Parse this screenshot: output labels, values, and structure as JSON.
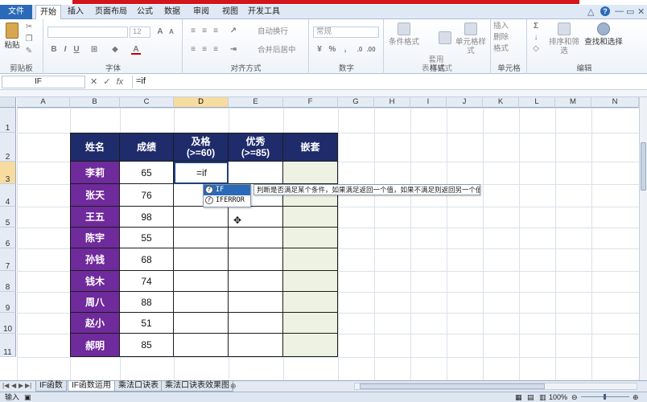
{
  "tabs": [
    "文件",
    "开始",
    "插入",
    "页面布局",
    "公式",
    "数据",
    "审阅",
    "视图",
    "开发工具"
  ],
  "active_tab": "开始",
  "window_controls": {
    "minimize": "△",
    "help": "?",
    "restore": "▭",
    "close": "✕"
  },
  "ribbon": {
    "paste_label": "粘贴",
    "clipboard_group": "剪贴板",
    "font_group": "字体",
    "font_size": "12",
    "align_group": "对齐方式",
    "wrap_text": "自动换行",
    "merge_center": "合并后居中",
    "number_group": "数字",
    "number_format": "常规",
    "styles_group": "样式",
    "cond_format": "条件格式",
    "table_format": "套用\n表格格式",
    "cell_style": "单元格样式",
    "cells_group": "单元格",
    "insert_btn": "插入",
    "delete_btn": "删除",
    "format_btn": "格式",
    "edit_group": "编辑",
    "sort_filter": "排序和筛选",
    "find_select": "查找和选择",
    "bold": "B",
    "italic": "I",
    "underline": "U",
    "grow_font": "A",
    "shrink_font": "A",
    "font_color": "A"
  },
  "formula_bar": {
    "name_box": "IF",
    "formula": "=if",
    "cancel": "✕",
    "enter": "✓",
    "fx": "fx"
  },
  "columns": [
    "A",
    "B",
    "C",
    "D",
    "E",
    "F",
    "G",
    "H",
    "I",
    "J",
    "K",
    "L",
    "M",
    "N"
  ],
  "rows": [
    "1",
    "2",
    "3",
    "4",
    "5",
    "6",
    "7",
    "8",
    "9",
    "10",
    "11"
  ],
  "table": {
    "headers": {
      "name": "姓名",
      "score": "成绩",
      "pass_line1": "及格",
      "pass_line2": "(>=60)",
      "excellent_line1": "优秀",
      "excellent_line2": "(>=85)",
      "nest": "嵌套"
    },
    "rows": [
      {
        "name": "李莉",
        "score": "65"
      },
      {
        "name": "张天",
        "score": "76"
      },
      {
        "name": "王五",
        "score": "98"
      },
      {
        "name": "陈宇",
        "score": "55"
      },
      {
        "name": "孙钱",
        "score": "68"
      },
      {
        "name": "钱木",
        "score": "74"
      },
      {
        "name": "周八",
        "score": "88"
      },
      {
        "name": "赵小",
        "score": "51"
      },
      {
        "name": "郝明",
        "score": "85"
      }
    ],
    "editing_value": "=if"
  },
  "autocomplete": {
    "items": [
      "IF",
      "IFERROR"
    ],
    "tooltip": "判断是否满足某个条件，如果满足返回一个值，如果不满足则返回另一个值。"
  },
  "sheets": [
    "IF函数",
    "IF函数运用",
    "乘法口诀表",
    "乘法口诀表效果图"
  ],
  "active_sheet": "IF函数运用",
  "status": {
    "mode": "输入",
    "zoom": "100%"
  },
  "colors": {
    "header_bg": "#1f2c6b",
    "name_bg": "#6f2a9b",
    "nest_bg": "#eef2e2",
    "accent": "#2a6ab8"
  }
}
